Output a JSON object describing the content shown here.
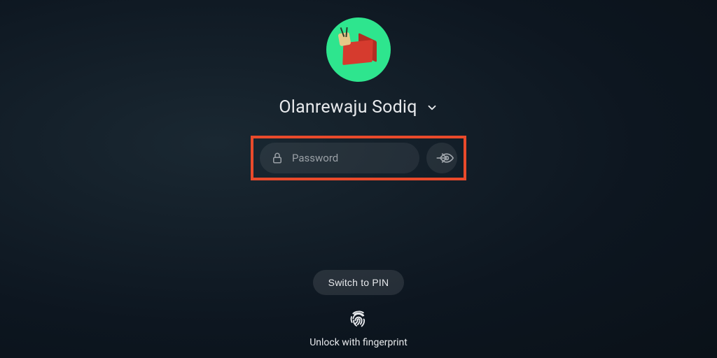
{
  "user": {
    "name": "Olanrewaju Sodiq"
  },
  "password": {
    "placeholder": "Password",
    "value": ""
  },
  "switch_button_label": "Switch to PIN",
  "fingerprint_text": "Unlock with fingerprint",
  "colors": {
    "avatar_bg": "#2ee58e",
    "highlight_border": "#e94a2b"
  }
}
